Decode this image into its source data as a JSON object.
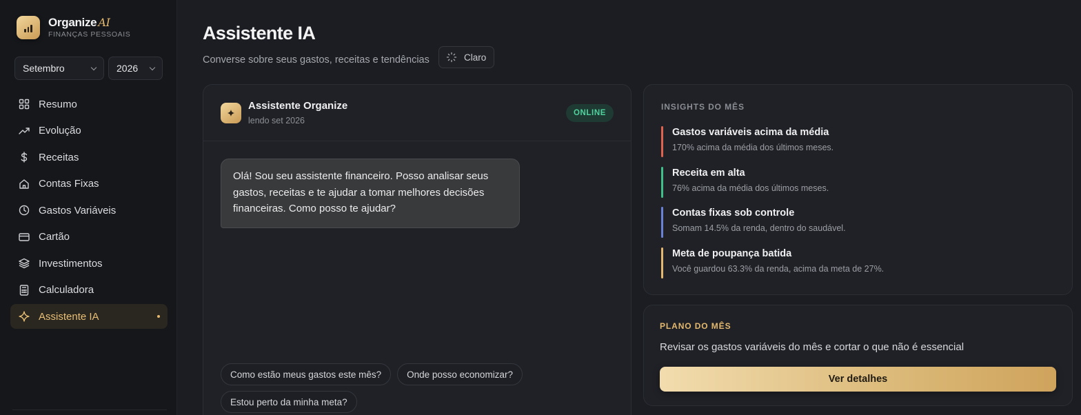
{
  "brand": {
    "name": "Organize",
    "ai": "AI",
    "subtitle": "FINANÇAS PESSOAIS"
  },
  "filters": {
    "month": "Setembro",
    "year": "2026"
  },
  "nav": [
    {
      "label": "Resumo",
      "icon": "grid-icon"
    },
    {
      "label": "Evolução",
      "icon": "trend-up-icon"
    },
    {
      "label": "Receitas",
      "icon": "dollar-icon"
    },
    {
      "label": "Contas Fixas",
      "icon": "home-icon"
    },
    {
      "label": "Gastos Variáveis",
      "icon": "clock-icon"
    },
    {
      "label": "Cartão",
      "icon": "credit-card-icon"
    },
    {
      "label": "Investimentos",
      "icon": "layers-icon"
    },
    {
      "label": "Calculadora",
      "icon": "calculator-icon"
    },
    {
      "label": "Assistente IA",
      "icon": "sparkle-icon",
      "active": true
    }
  ],
  "header": {
    "title": "Assistente IA",
    "subtitle": "Converse sobre seus gastos, receitas e tendências",
    "theme_button": "Claro"
  },
  "chat": {
    "bot_name": "Assistente Organize",
    "bot_status": "lendo set 2026",
    "online_badge": "ONLINE",
    "message": "Olá! Sou seu assistente financeiro. Posso analisar seus gastos, receitas e te ajudar a tomar melhores decisões financeiras. Como posso te ajudar?",
    "suggestions": [
      "Como estão meus gastos este mês?",
      "Onde posso economizar?",
      "Estou perto da minha meta?"
    ]
  },
  "insights": {
    "title": "INSIGHTS DO MÊS",
    "items": [
      {
        "title": "Gastos variáveis acima da média",
        "desc": "170% acima da média dos últimos meses.",
        "color": "#e0634f"
      },
      {
        "title": "Receita em alta",
        "desc": "76% acima da média dos últimos meses.",
        "color": "#3fbf8a"
      },
      {
        "title": "Contas fixas sob controle",
        "desc": "Somam 14.5% da renda, dentro do saudável.",
        "color": "#6a82d6"
      },
      {
        "title": "Meta de poupança batida",
        "desc": "Você guardou 63.3% da renda, acima da meta de 27%.",
        "color": "#e4b86e"
      }
    ]
  },
  "plan": {
    "title": "PLANO DO MÊS",
    "text": "Revisar os gastos variáveis do mês e cortar o que não é essencial",
    "button": "Ver detalhes"
  }
}
